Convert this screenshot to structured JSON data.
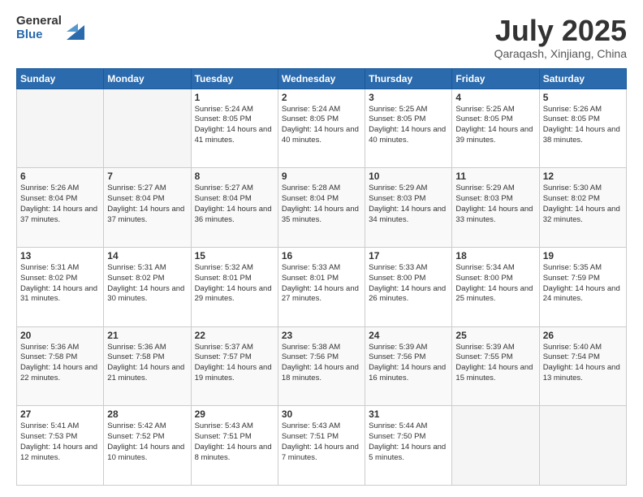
{
  "header": {
    "logo_general": "General",
    "logo_blue": "Blue",
    "title": "July 2025",
    "location": "Qaraqash, Xinjiang, China"
  },
  "calendar": {
    "weekdays": [
      "Sunday",
      "Monday",
      "Tuesday",
      "Wednesday",
      "Thursday",
      "Friday",
      "Saturday"
    ],
    "weeks": [
      [
        {
          "day": "",
          "empty": true
        },
        {
          "day": "",
          "empty": true
        },
        {
          "day": "1",
          "sunrise": "5:24 AM",
          "sunset": "8:05 PM",
          "daylight": "14 hours and 41 minutes."
        },
        {
          "day": "2",
          "sunrise": "5:24 AM",
          "sunset": "8:05 PM",
          "daylight": "14 hours and 40 minutes."
        },
        {
          "day": "3",
          "sunrise": "5:25 AM",
          "sunset": "8:05 PM",
          "daylight": "14 hours and 40 minutes."
        },
        {
          "day": "4",
          "sunrise": "5:25 AM",
          "sunset": "8:05 PM",
          "daylight": "14 hours and 39 minutes."
        },
        {
          "day": "5",
          "sunrise": "5:26 AM",
          "sunset": "8:05 PM",
          "daylight": "14 hours and 38 minutes."
        }
      ],
      [
        {
          "day": "6",
          "sunrise": "5:26 AM",
          "sunset": "8:04 PM",
          "daylight": "14 hours and 37 minutes."
        },
        {
          "day": "7",
          "sunrise": "5:27 AM",
          "sunset": "8:04 PM",
          "daylight": "14 hours and 37 minutes."
        },
        {
          "day": "8",
          "sunrise": "5:27 AM",
          "sunset": "8:04 PM",
          "daylight": "14 hours and 36 minutes."
        },
        {
          "day": "9",
          "sunrise": "5:28 AM",
          "sunset": "8:04 PM",
          "daylight": "14 hours and 35 minutes."
        },
        {
          "day": "10",
          "sunrise": "5:29 AM",
          "sunset": "8:03 PM",
          "daylight": "14 hours and 34 minutes."
        },
        {
          "day": "11",
          "sunrise": "5:29 AM",
          "sunset": "8:03 PM",
          "daylight": "14 hours and 33 minutes."
        },
        {
          "day": "12",
          "sunrise": "5:30 AM",
          "sunset": "8:02 PM",
          "daylight": "14 hours and 32 minutes."
        }
      ],
      [
        {
          "day": "13",
          "sunrise": "5:31 AM",
          "sunset": "8:02 PM",
          "daylight": "14 hours and 31 minutes."
        },
        {
          "day": "14",
          "sunrise": "5:31 AM",
          "sunset": "8:02 PM",
          "daylight": "14 hours and 30 minutes."
        },
        {
          "day": "15",
          "sunrise": "5:32 AM",
          "sunset": "8:01 PM",
          "daylight": "14 hours and 29 minutes."
        },
        {
          "day": "16",
          "sunrise": "5:33 AM",
          "sunset": "8:01 PM",
          "daylight": "14 hours and 27 minutes."
        },
        {
          "day": "17",
          "sunrise": "5:33 AM",
          "sunset": "8:00 PM",
          "daylight": "14 hours and 26 minutes."
        },
        {
          "day": "18",
          "sunrise": "5:34 AM",
          "sunset": "8:00 PM",
          "daylight": "14 hours and 25 minutes."
        },
        {
          "day": "19",
          "sunrise": "5:35 AM",
          "sunset": "7:59 PM",
          "daylight": "14 hours and 24 minutes."
        }
      ],
      [
        {
          "day": "20",
          "sunrise": "5:36 AM",
          "sunset": "7:58 PM",
          "daylight": "14 hours and 22 minutes."
        },
        {
          "day": "21",
          "sunrise": "5:36 AM",
          "sunset": "7:58 PM",
          "daylight": "14 hours and 21 minutes."
        },
        {
          "day": "22",
          "sunrise": "5:37 AM",
          "sunset": "7:57 PM",
          "daylight": "14 hours and 19 minutes."
        },
        {
          "day": "23",
          "sunrise": "5:38 AM",
          "sunset": "7:56 PM",
          "daylight": "14 hours and 18 minutes."
        },
        {
          "day": "24",
          "sunrise": "5:39 AM",
          "sunset": "7:56 PM",
          "daylight": "14 hours and 16 minutes."
        },
        {
          "day": "25",
          "sunrise": "5:39 AM",
          "sunset": "7:55 PM",
          "daylight": "14 hours and 15 minutes."
        },
        {
          "day": "26",
          "sunrise": "5:40 AM",
          "sunset": "7:54 PM",
          "daylight": "14 hours and 13 minutes."
        }
      ],
      [
        {
          "day": "27",
          "sunrise": "5:41 AM",
          "sunset": "7:53 PM",
          "daylight": "14 hours and 12 minutes."
        },
        {
          "day": "28",
          "sunrise": "5:42 AM",
          "sunset": "7:52 PM",
          "daylight": "14 hours and 10 minutes."
        },
        {
          "day": "29",
          "sunrise": "5:43 AM",
          "sunset": "7:51 PM",
          "daylight": "14 hours and 8 minutes."
        },
        {
          "day": "30",
          "sunrise": "5:43 AM",
          "sunset": "7:51 PM",
          "daylight": "14 hours and 7 minutes."
        },
        {
          "day": "31",
          "sunrise": "5:44 AM",
          "sunset": "7:50 PM",
          "daylight": "14 hours and 5 minutes."
        },
        {
          "day": "",
          "empty": true
        },
        {
          "day": "",
          "empty": true
        }
      ]
    ]
  }
}
